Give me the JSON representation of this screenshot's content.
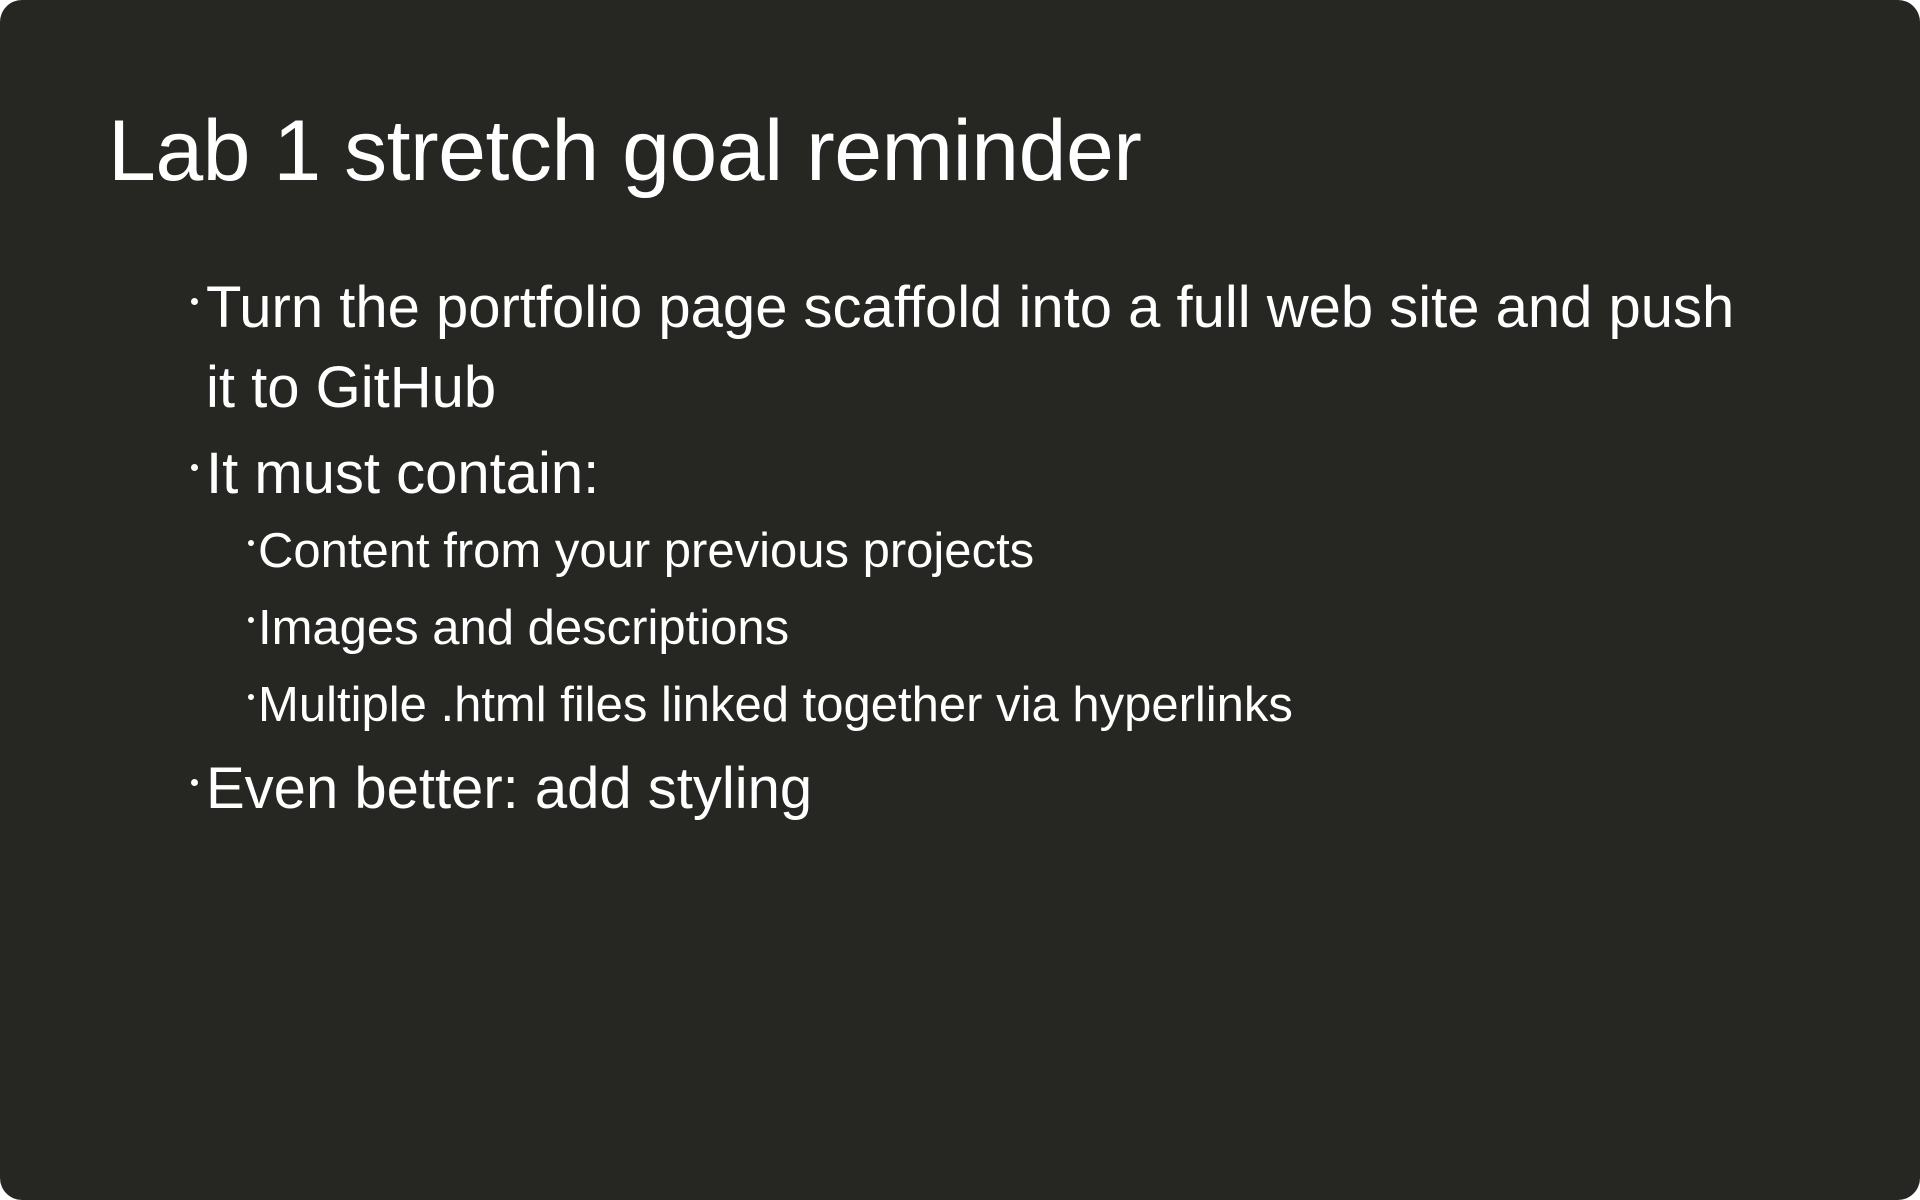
{
  "slide": {
    "title": "Lab 1 stretch goal reminder",
    "bullets": [
      "Turn the portfolio page scaffold into a full web site and push it to GitHub",
      "It must contain:",
      "Even better: add styling"
    ],
    "sub_bullets": [
      "Content from your previous projects",
      "Images and descriptions",
      "Multiple .html files linked together via hyperlinks"
    ]
  },
  "colors": {
    "background": "#262623",
    "text": "#ffffff"
  }
}
